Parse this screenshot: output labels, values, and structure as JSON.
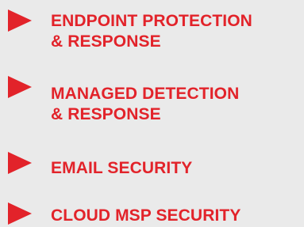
{
  "menu": {
    "accent_color": "#e2232a",
    "background_color": "#eaeaea",
    "items": [
      {
        "id": "endpoint-protection-response",
        "icon": "triangle-arrow-right-icon",
        "label_lines": [
          "ENDPOINT PROTECTION",
          "& RESPONSE"
        ]
      },
      {
        "id": "managed-detection-response",
        "icon": "triangle-arrow-right-icon",
        "label_lines": [
          "MANAGED DETECTION",
          "& RESPONSE"
        ]
      },
      {
        "id": "email-security",
        "icon": "triangle-arrow-right-icon",
        "label_lines": [
          "EMAIL SECURITY"
        ]
      },
      {
        "id": "cloud-msp-security",
        "icon": "triangle-arrow-right-icon",
        "label_lines": [
          "CLOUD MSP SECURITY"
        ]
      }
    ]
  }
}
